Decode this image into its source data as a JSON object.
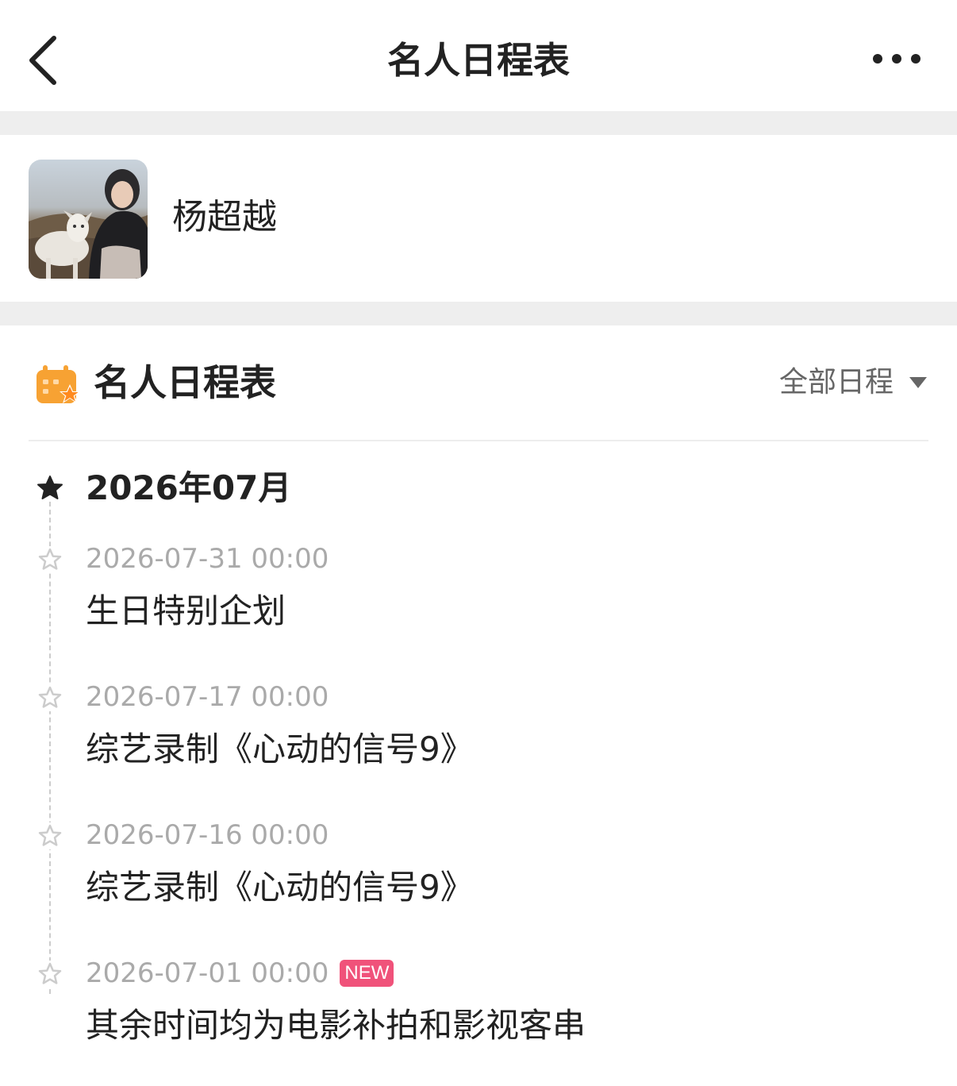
{
  "nav": {
    "title": "名人日程表",
    "back_icon": "chevron-left-icon",
    "more_icon": "more-dots-icon"
  },
  "profile": {
    "name": "杨超越",
    "avatar": "avatar-photo"
  },
  "schedule": {
    "title": "名人日程表",
    "icon": "calendar-star-icon",
    "filter_label": "全部日程",
    "filter_icon": "triangle-down-icon",
    "accent_color": "#f7a233"
  },
  "timeline": {
    "month": "2026年07月",
    "events": [
      {
        "time": "2026-07-31 00:00",
        "title": "生日特别企划"
      },
      {
        "time": "2026-07-17 00:00",
        "title": "综艺录制《心动的信号9》"
      },
      {
        "time": "2026-07-16 00:00",
        "title": "综艺录制《心动的信号9》"
      },
      {
        "time": "2026-07-01 00:00",
        "title": "其余时间均为电影补拍和影视客串",
        "badge": "NEW"
      }
    ]
  },
  "colors": {
    "background": "#ffffff",
    "divider": "#eeeeee",
    "new_badge": "#f0527a",
    "secondary_text": "#aaaaaa"
  }
}
